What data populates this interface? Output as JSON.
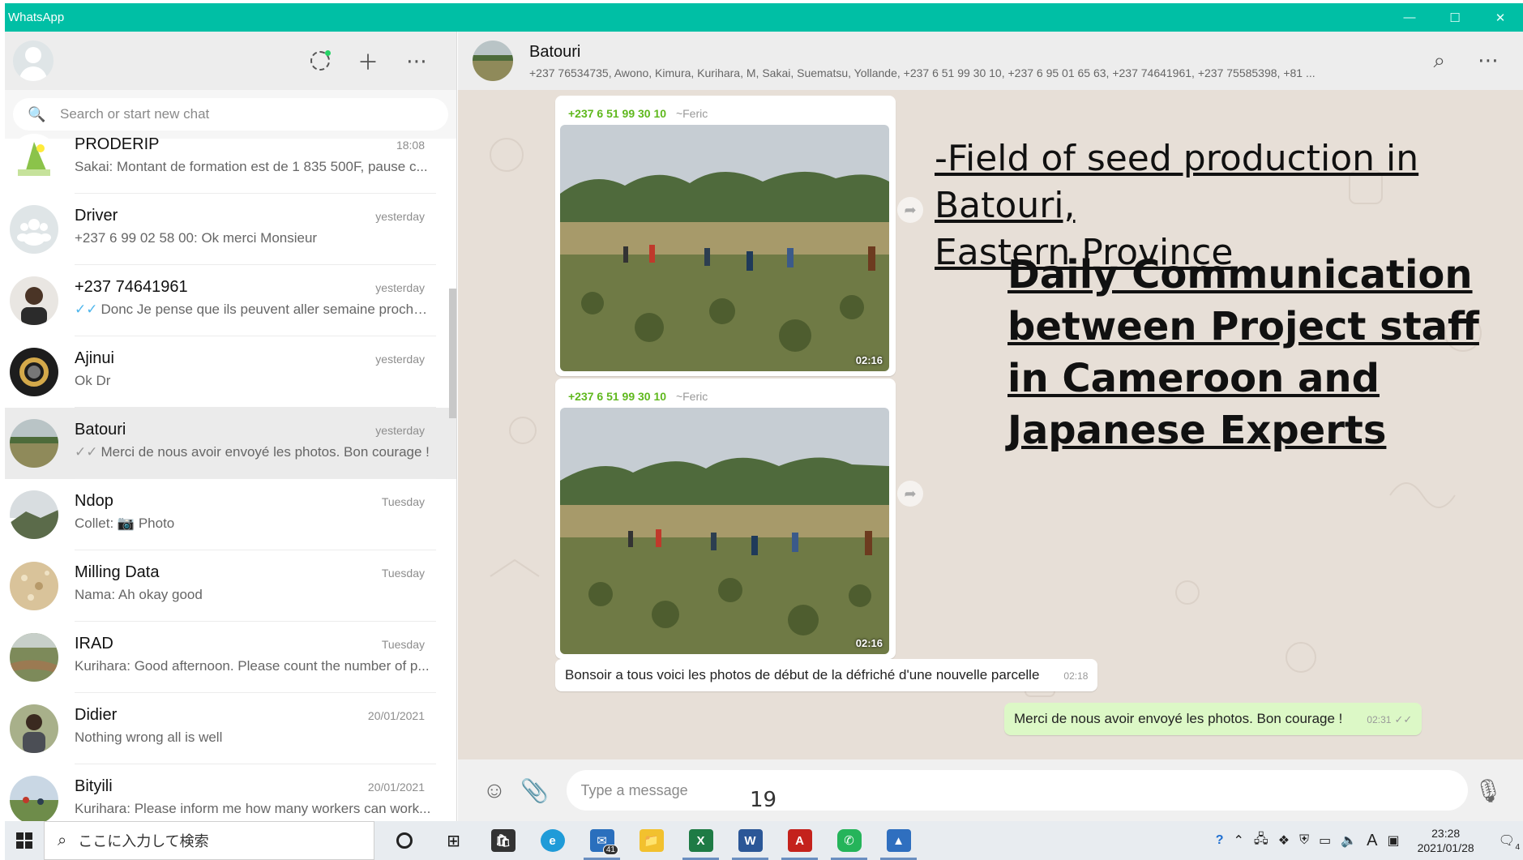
{
  "window": {
    "title": "WhatsApp",
    "minimize": "—",
    "maximize": "☐",
    "close": "✕"
  },
  "sidebar": {
    "search_placeholder": "Search or start new chat",
    "chats": [
      {
        "name": "PRODERIP",
        "time": "18:08",
        "preview": "Sakai: Montant de formation est de 1 835 500F, pause c..."
      },
      {
        "name": "Driver",
        "time": "yesterday",
        "preview": "+237 6 99 02 58 00: Ok merci Monsieur"
      },
      {
        "name": "+237 74641961",
        "time": "yesterday",
        "preview": "Donc Je pense que ils peuvent aller semaine prochai..."
      },
      {
        "name": "Ajinui",
        "time": "yesterday",
        "preview": "Ok Dr"
      },
      {
        "name": "Batouri",
        "time": "yesterday",
        "preview": "Merci de nous avoir envoyé les photos. Bon courage !"
      },
      {
        "name": "Ndop",
        "time": "Tuesday",
        "preview_sender": "Collet:",
        "preview": "Photo"
      },
      {
        "name": "Milling Data",
        "time": "Tuesday",
        "preview": "Nama: Ah okay good"
      },
      {
        "name": "IRAD",
        "time": "Tuesday",
        "preview": "Kurihara: Good afternoon. Please count the number of p..."
      },
      {
        "name": "Didier",
        "time": "20/01/2021",
        "preview": "Nothing wrong all is well"
      },
      {
        "name": "Bityili",
        "time": "20/01/2021",
        "preview": "Kurihara: Please inform me how many workers can work..."
      }
    ]
  },
  "chat": {
    "title": "Batouri",
    "members": "+237 76534735, Awono, Kimura, Kurihara, M, Sakai, Suematsu, Yollande, +237 6 51 99 30 10, +237 6 95 01 65 63, +237 74641961, +237 75585398, +81 ...",
    "messages": [
      {
        "sender": "+237 6 51 99 30 10",
        "alias": "~Feric",
        "time": "02:16"
      },
      {
        "sender": "+237 6 51 99 30 10",
        "alias": "~Feric",
        "time": "02:16"
      }
    ],
    "text_in": {
      "text": "Bonsoir a tous voici les photos de début de la défriché d'une nouvelle parcelle",
      "time": "02:18"
    },
    "text_out": {
      "text": "Merci de nous avoir envoyé les photos. Bon courage !",
      "time": "02:31"
    },
    "compose_placeholder": "Type a message"
  },
  "overlay": {
    "line1": "-Field of seed production in Batouri,",
    "line2": "Eastern Province",
    "heading": [
      "Daily Communication",
      "between Project staff",
      "in Cameroon and",
      "Japanese Experts"
    ]
  },
  "slide_number": "19",
  "taskbar": {
    "search_text": "ここに入力して検索",
    "mail_badge": "41",
    "clock_time": "23:28",
    "clock_date": "2021/01/28",
    "notif_count": "4"
  }
}
